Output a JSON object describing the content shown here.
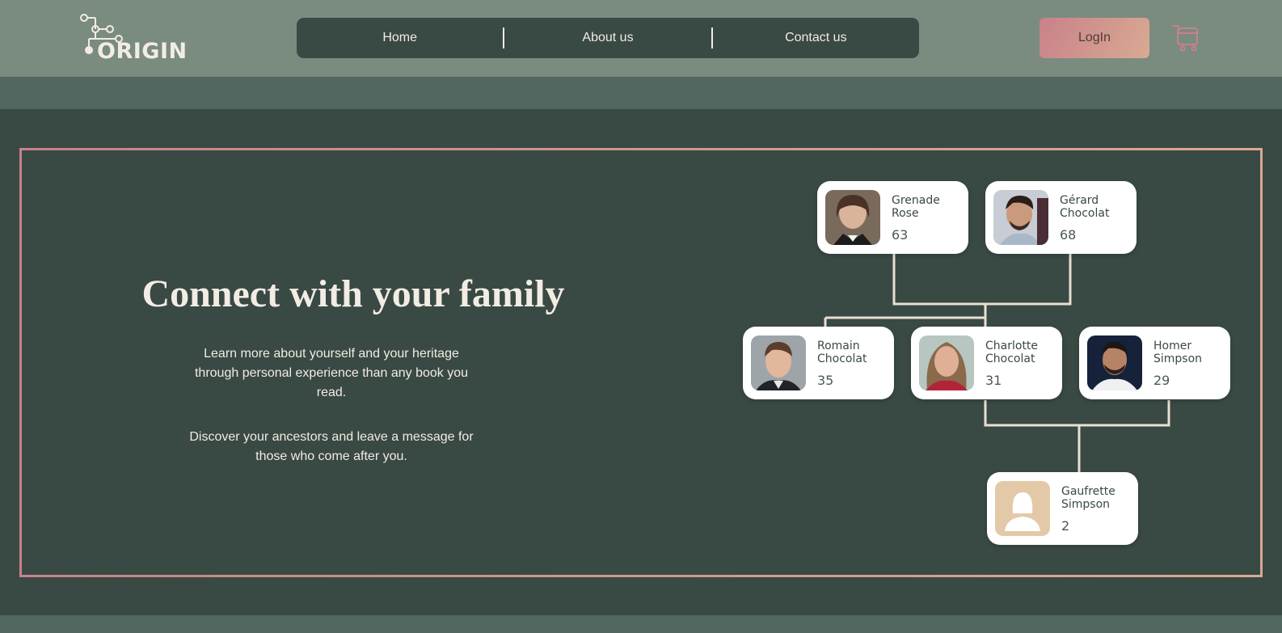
{
  "header": {
    "logo_text": "ORIGIN",
    "nav": [
      "Home",
      "About us",
      "Contact us"
    ],
    "login_label": "LogIn",
    "cart_icon": "cart-icon"
  },
  "hero": {
    "title": "Connect with your family",
    "paragraph_1": "Learn more about yourself and your heritage through personal experience than any book you read.",
    "paragraph_2": "Discover your ancestors and leave a message for those who come after you."
  },
  "family": [
    {
      "name": "Grenade Rose",
      "age": "63"
    },
    {
      "name": "Gérard Chocolat",
      "age": "68"
    },
    {
      "name": "Romain Chocolat",
      "age": "35"
    },
    {
      "name": "Charlotte Chocolat",
      "age": "31"
    },
    {
      "name": "Homer Simpson",
      "age": "29"
    },
    {
      "name": "Gaufrette Simpson",
      "age": "2"
    }
  ],
  "colors": {
    "header_bg": "#7a8b7f",
    "main_bg": "#394943",
    "band_bg": "#516760",
    "accent_gradient_start": "#c9818a",
    "accent_gradient_end": "#d8aa92",
    "text_light": "#f2ece4"
  }
}
